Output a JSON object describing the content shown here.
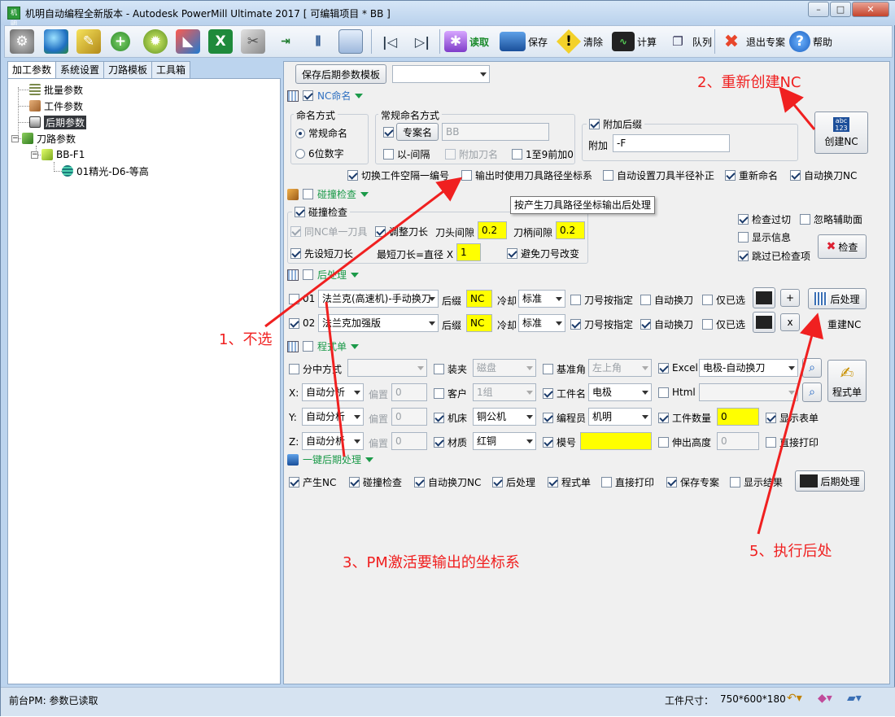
{
  "window": {
    "title": "机明自动编程全新版本 - Autodesk PowerMill Ultimate 2017    [ 可编辑项目 * BB ]",
    "icon_text": "机明",
    "min": "–",
    "max": "□",
    "close": "✕"
  },
  "toolbar": {
    "icons": [
      "gear-icon",
      "globe-icon",
      "paint-icon",
      "add-icon",
      "virus-icon",
      "magnet-icon",
      "excel-icon",
      "wrench-icon",
      "insert-icon",
      "tree-icon",
      "folder-icon",
      "first-icon",
      "last-icon"
    ],
    "read_label": "读取",
    "save_label": "保存",
    "clear_label": "清除",
    "calc_label": "计算",
    "queue_label": "队列",
    "exit_label": "退出专案",
    "help_label": "帮助"
  },
  "left": {
    "tabs": [
      "加工参数",
      "系统设置",
      "刀路模板",
      "工具箱"
    ],
    "tree": [
      "批量参数",
      "工件参数",
      "后期参数",
      "刀路参数",
      "BB-F1",
      "01精光-D6-等高"
    ]
  },
  "right": {
    "save_template_btn": "保存后期参数模板",
    "template_select": "",
    "nc": {
      "section": "NC命名",
      "naming_group": "命名方式",
      "radio_normal": "常规命名",
      "radio_6digit": "6位数字",
      "normal_group": "常规命名方式",
      "project_btn": "专案名",
      "project_value": "BB",
      "interval": "以-间隔",
      "add_tool": "附加刀名",
      "one_to_nine": "1至9前加0",
      "suffix_group": "附加后缀",
      "suffix_label": "附加",
      "suffix_value": "-F",
      "create_nc_btn": "创建NC",
      "abc_icon": "abc 123",
      "opt1": "切换工件空隔一编号",
      "opt2": "输出时使用刀具路径坐标系",
      "opt3": "自动设置刀具半径补正",
      "opt4": "重新命名",
      "opt5": "自动换刀NC",
      "tooltip": "按产生刀具路径坐标输出后处理"
    },
    "collision": {
      "section": "碰撞检查",
      "group": "碰撞检查",
      "same_tool": "同NC单一刀具",
      "adjust_len": "调整刀长",
      "head_gap": "刀头间隙",
      "head_val": "0.2",
      "shank_gap": "刀柄间隙",
      "shank_val": "0.2",
      "preset_short": "先设短刀长",
      "min_len": "最短刀长=直径 X",
      "min_val": "1",
      "avoid": "避免刀号改变",
      "overcut": "检查过切",
      "ignore": "忽略辅助面",
      "show_info": "显示信息",
      "skip": "跳过已检查项",
      "check_btn": "检查"
    },
    "post": {
      "section": "后处理",
      "rows": [
        {
          "no": "01",
          "machine": "法兰克(高速机)-手动换刀",
          "suffix_label": "后缀",
          "suffix": "NC",
          "cool_label": "冷却",
          "cool": "标准",
          "tool_num": "刀号按指定",
          "auto": "自动换刀",
          "only": "仅已选",
          "small_btn": "+"
        },
        {
          "no": "02",
          "machine": "法兰克加强版",
          "suffix_label": "后缀",
          "suffix": "NC",
          "cool_label": "冷却",
          "cool": "标准",
          "tool_num": "刀号按指定",
          "auto": "自动换刀",
          "only": "仅已选",
          "small_btn": "x"
        }
      ],
      "post_btn": "后处理",
      "rebuild": "重建NC"
    },
    "sheet": {
      "section": "程式单",
      "split": "分中方式",
      "clamp": "装夹",
      "clamp_val": "磁盘",
      "datum": "基准角",
      "datum_val": "左上角",
      "excel": "Excel",
      "excel_val": "电极-自动换刀",
      "html": "Html",
      "sheet_btn": "程式单",
      "axes": [
        {
          "label": "X:",
          "mode": "自动分析",
          "off": "偏置",
          "val": "0"
        },
        {
          "label": "Y:",
          "mode": "自动分析",
          "off": "偏置",
          "val": "0"
        },
        {
          "label": "Z:",
          "mode": "自动分析",
          "off": "偏置",
          "val": "0"
        }
      ],
      "client": "客户",
      "client_val": "1组",
      "machine": "机床",
      "machine_val": "铜公机",
      "material": "材质",
      "material_val": "红铜",
      "part": "工件名",
      "part_val": "电极",
      "programmer": "编程员",
      "programmer_val": "机明",
      "mold": "模号",
      "qty": "工件数量",
      "qty_val": "0",
      "extend": "伸出高度",
      "extend_val": "0",
      "show_table": "显示表单",
      "direct_print": "直接打印"
    },
    "onekey": {
      "section": "一键后期处理",
      "items": [
        "产生NC",
        "碰撞检查",
        "自动换刀NC",
        "后处理",
        "程式单",
        "直接打印",
        "保存专案",
        "显示结果"
      ],
      "btn": "后期处理"
    }
  },
  "annotations": {
    "a1": "1、不选",
    "a2": "2、重新创建NC",
    "a3": "3、PM激活要输出的坐标系",
    "a5": "5、执行后处"
  },
  "status": {
    "left": "前台PM: 参数已读取",
    "size_label": "工件尺寸：",
    "size_value": "750*600*180"
  },
  "colors": {
    "annotation": "#f02020",
    "highlight": "#ffff00",
    "accent": "#1b9a49"
  }
}
